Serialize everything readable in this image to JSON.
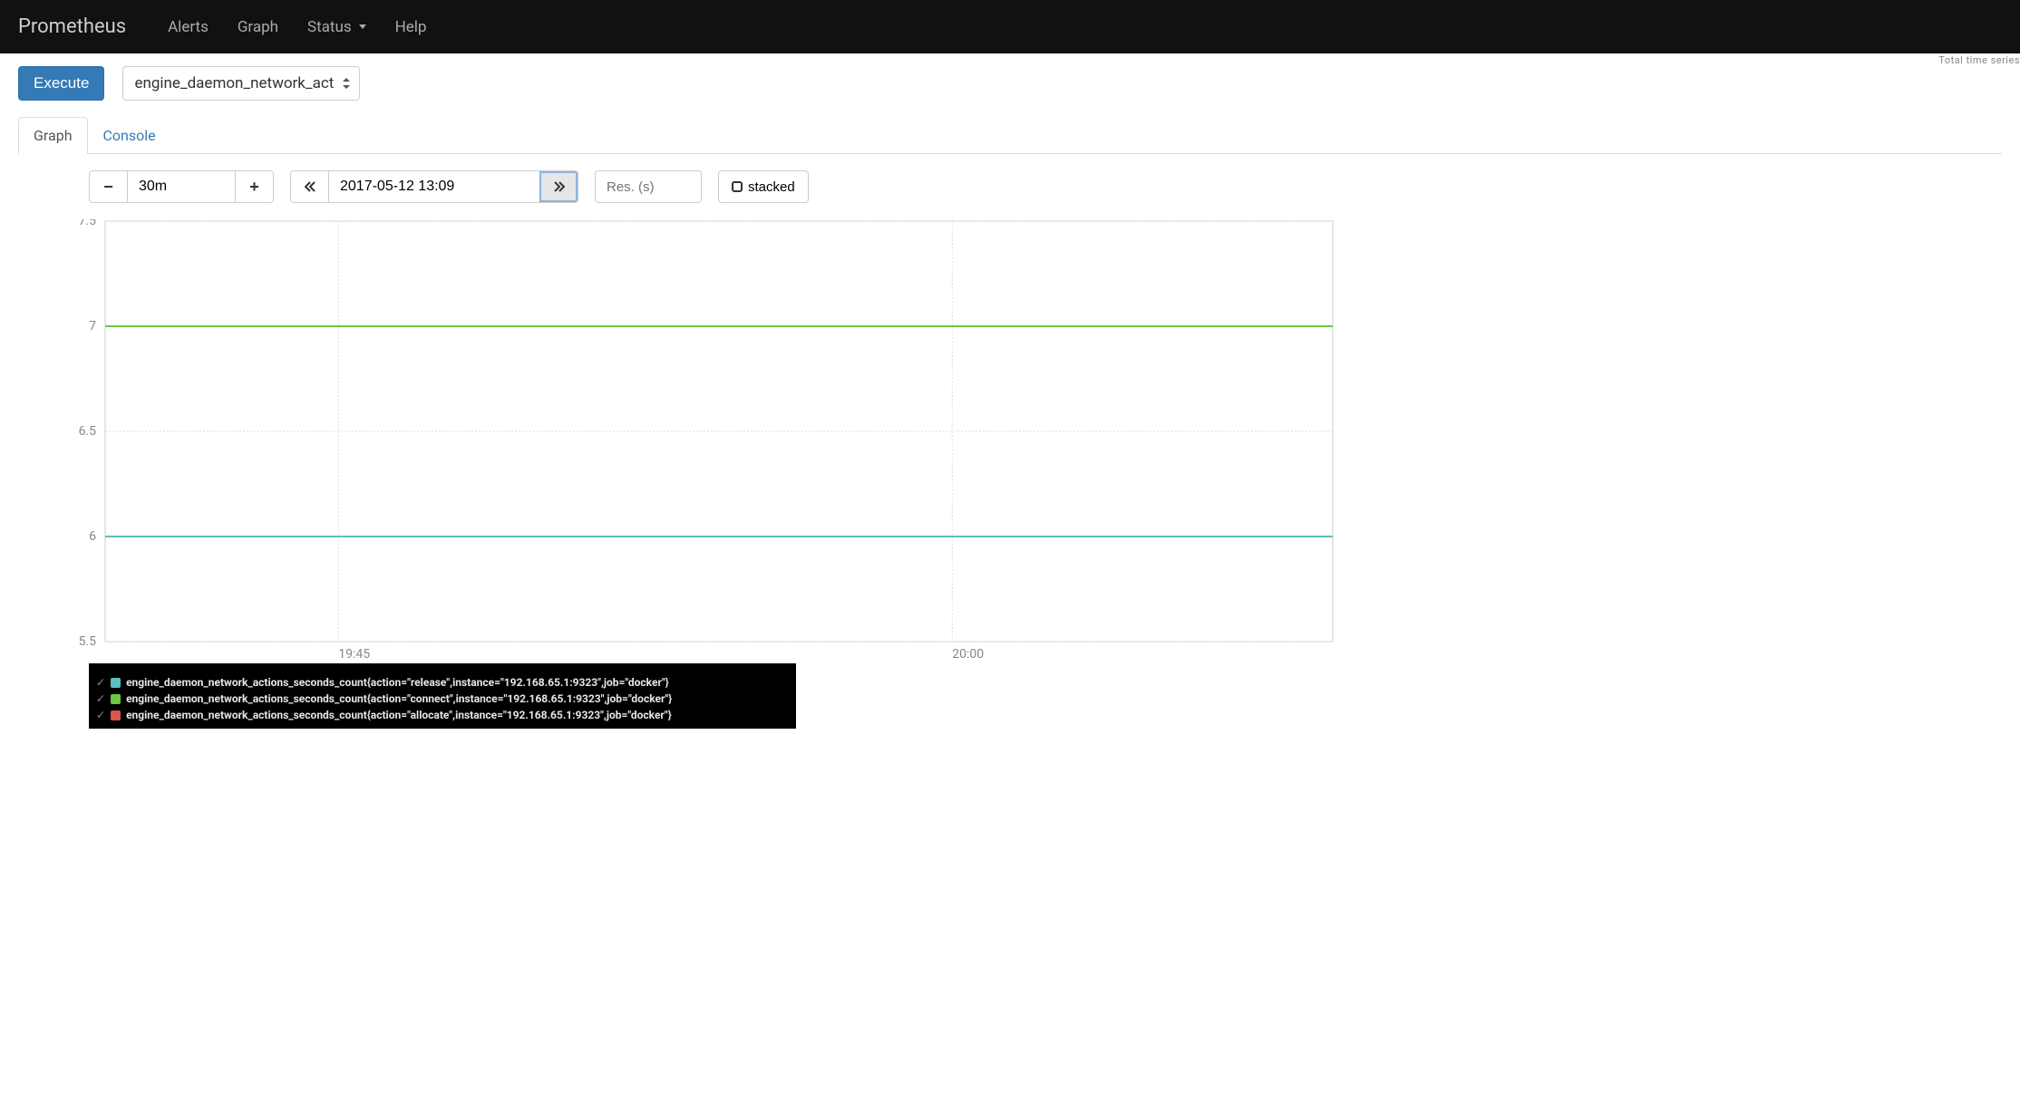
{
  "nav": {
    "brand": "Prometheus",
    "items": [
      "Alerts",
      "Graph",
      "Status",
      "Help"
    ],
    "dropdown_index": 2
  },
  "clip_text": "Total time series",
  "toolbar": {
    "execute_label": "Execute",
    "metric_select": "engine_daemon_network_act"
  },
  "tabs": {
    "graph": "Graph",
    "console": "Console",
    "active": "graph"
  },
  "controls": {
    "range": "30m",
    "datetime": "2017-05-12 13:09",
    "res_placeholder": "Res. (s)",
    "stacked_label": "stacked"
  },
  "chart_data": {
    "type": "line",
    "xlabel": "",
    "ylabel": "",
    "ylim": [
      5.5,
      7.5
    ],
    "y_ticks": [
      5.5,
      6,
      6.5,
      7,
      7.5
    ],
    "x_ticks": [
      "19:45",
      "20:00"
    ],
    "series": [
      {
        "name": "engine_daemon_network_actions_seconds_count{action=\"release\",instance=\"192.168.65.1:9323\",job=\"docker\"}",
        "color": "#5bc0be",
        "value": 6
      },
      {
        "name": "engine_daemon_network_actions_seconds_count{action=\"connect\",instance=\"192.168.65.1:9323\",job=\"docker\"}",
        "color": "#6cc644",
        "value": 7
      },
      {
        "name": "engine_daemon_network_actions_seconds_count{action=\"allocate\",instance=\"192.168.65.1:9323\",job=\"docker\"}",
        "color": "#d9564a",
        "value": null
      }
    ]
  }
}
